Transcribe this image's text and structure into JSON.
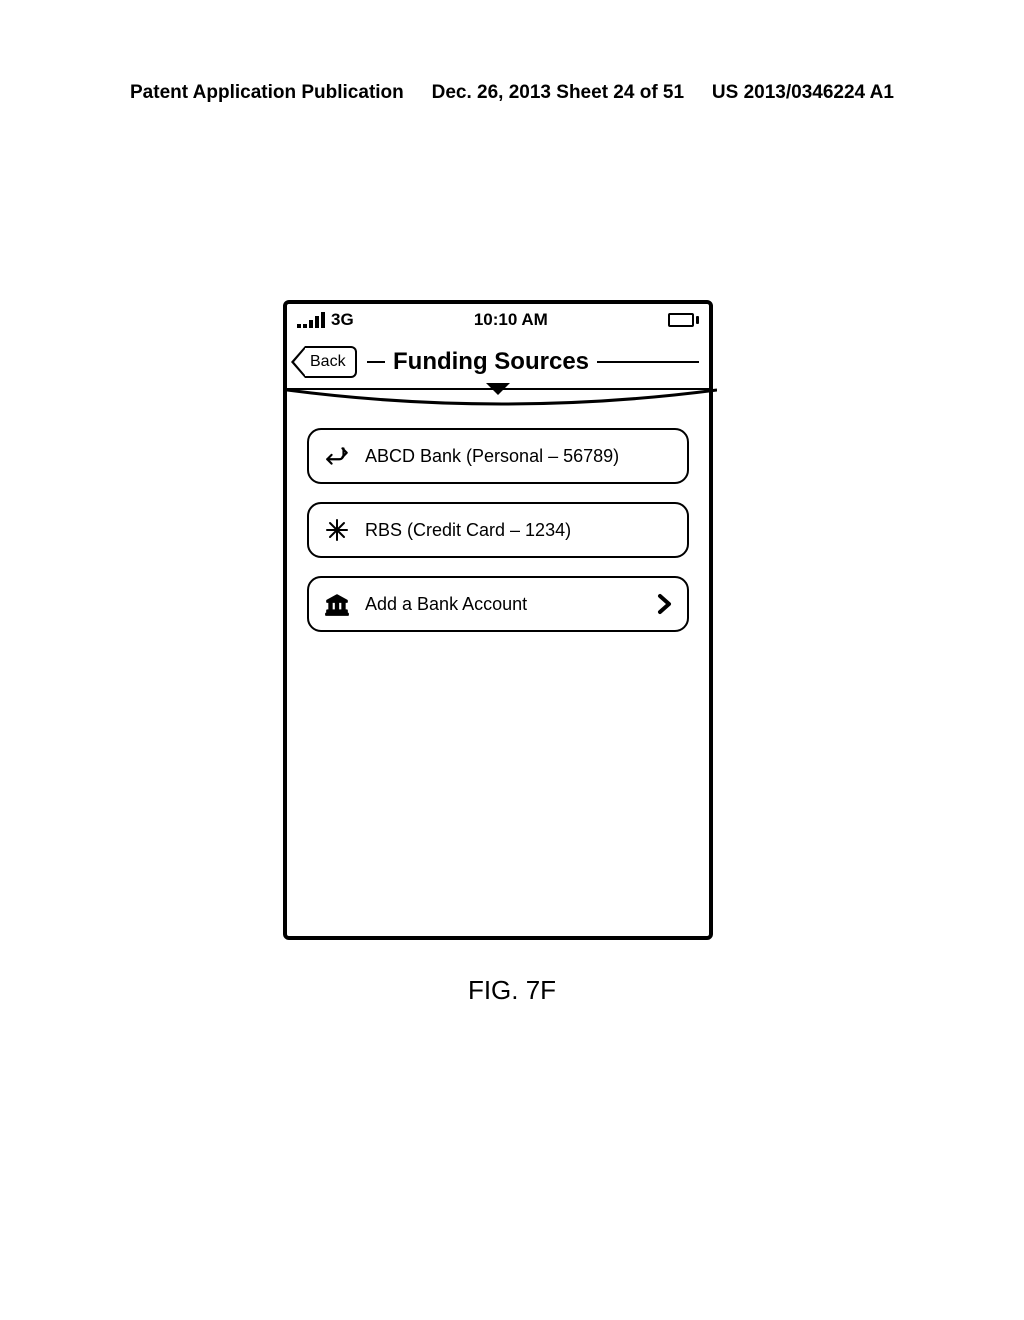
{
  "doc_header": {
    "left": "Patent Application Publication",
    "center": "Dec. 26, 2013  Sheet 24 of 51",
    "right": "US 2013/0346224 A1"
  },
  "status": {
    "network": "3G",
    "time": "10:10 AM"
  },
  "nav": {
    "back_label": "Back",
    "title": "Funding Sources"
  },
  "rows": [
    {
      "label": "ABCD Bank (Personal – 56789)"
    },
    {
      "label": "RBS (Credit Card – 1234)"
    },
    {
      "label": "Add a Bank Account"
    }
  ],
  "figure_label": "FIG. 7F"
}
